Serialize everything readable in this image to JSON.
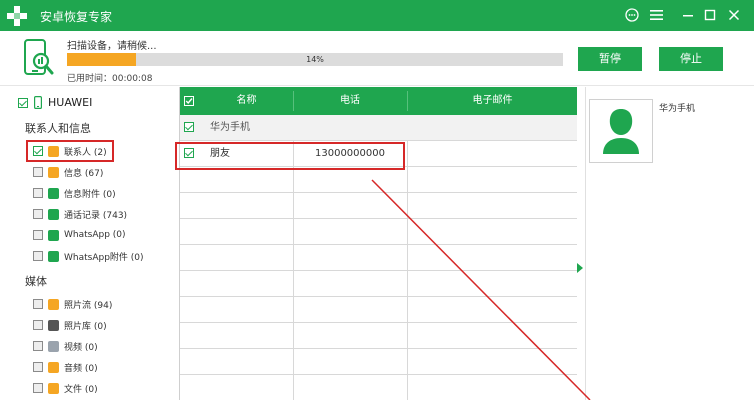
{
  "app": {
    "title": "安卓恢复专家"
  },
  "titlebar": {
    "chat_glyph": "💬",
    "menu_glyph": "☰",
    "minimize_glyph": "—",
    "maximize_glyph": "□",
    "close_glyph": "✕"
  },
  "scan": {
    "status_text": "扫描设备，请稍候...",
    "progress_text": "14%",
    "progress_fraction": 0.14,
    "elapsed_text": "已用时间：00:00:08",
    "pause_label": "暂停",
    "stop_label": "停止"
  },
  "sidebar": {
    "device_name": "HUAWEI",
    "contacts_section": "联系人和信息",
    "contacts_items": [
      {
        "label": "联系人 (2)",
        "icon": "contacts-icon",
        "color": "#f5a623",
        "checked": true
      },
      {
        "label": "信息 (67)",
        "icon": "message-icon",
        "color": "#f5a623",
        "checked": false
      },
      {
        "label": "信息附件 (0)",
        "icon": "attachment-icon",
        "color": "#1fa64f",
        "checked": false
      },
      {
        "label": "通话记录 (743)",
        "icon": "phone-icon",
        "color": "#1fa64f",
        "checked": false
      },
      {
        "label": "WhatsApp (0)",
        "icon": "whatsapp-icon",
        "color": "#1fa64f",
        "checked": false
      },
      {
        "label": "WhatsApp附件 (0)",
        "icon": "whatsapp-attachment-icon",
        "color": "#1fa64f",
        "checked": false
      }
    ],
    "media_section": "媒体",
    "media_items": [
      {
        "label": "照片流 (94)",
        "icon": "photostream-icon",
        "color": "#f5a623",
        "checked": false
      },
      {
        "label": "照片库 (0)",
        "icon": "photo-library-icon",
        "color": "#555555",
        "checked": false
      },
      {
        "label": "视频 (0)",
        "icon": "video-icon",
        "color": "#9aa3ad",
        "checked": false
      },
      {
        "label": "音频 (0)",
        "icon": "audio-icon",
        "color": "#f5a623",
        "checked": false
      },
      {
        "label": "文件 (0)",
        "icon": "file-icon",
        "color": "#f5a623",
        "checked": false
      }
    ]
  },
  "table": {
    "headers": {
      "name": "名称",
      "phone": "电话",
      "email": "电子邮件"
    },
    "group_label": "华为手机",
    "rows": [
      {
        "name": "朋友",
        "phone": "13000000000",
        "email": ""
      }
    ]
  },
  "detail": {
    "contact_name": "华为手机"
  },
  "colors": {
    "brand": "#1fa64f",
    "progress": "#f5a623",
    "annotation": "#d62828"
  }
}
